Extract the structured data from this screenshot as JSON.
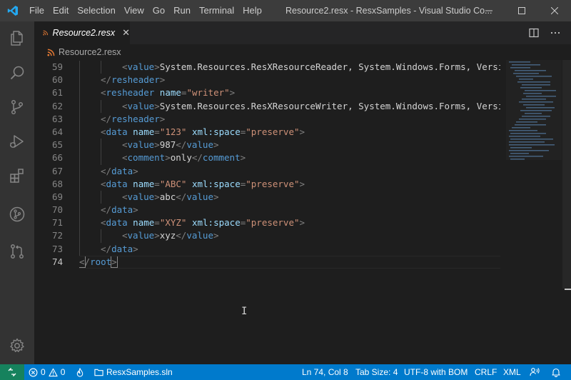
{
  "window": {
    "title": "Resource2.resx - ResxSamples - Visual Studio Co..."
  },
  "menu": [
    "File",
    "Edit",
    "Selection",
    "View",
    "Go",
    "Run",
    "Terminal",
    "Help"
  ],
  "tab": {
    "label": "Resource2.resx",
    "close": "✕"
  },
  "breadcrumb": {
    "file": "Resource2.resx"
  },
  "editor": {
    "cursor_glyph": "I",
    "active_line": 74,
    "lines": [
      {
        "n": "59"
      },
      {
        "n": "60"
      },
      {
        "n": "61"
      },
      {
        "n": "62"
      },
      {
        "n": "63"
      },
      {
        "n": "64"
      },
      {
        "n": "65"
      },
      {
        "n": "66"
      },
      {
        "n": "67"
      },
      {
        "n": "68"
      },
      {
        "n": "69"
      },
      {
        "n": "70"
      },
      {
        "n": "71"
      },
      {
        "n": "72"
      },
      {
        "n": "73"
      },
      {
        "n": "74"
      }
    ],
    "code": {
      "l59_tag": "value",
      "l59_text": "System.Resources.ResXResourceReader, System.Windows.Forms, Versio",
      "l60_tag": "resheader",
      "l61_tag": "resheader",
      "l61_attr": "name",
      "l61_val": "\"writer\"",
      "l62_tag": "value",
      "l62_text": "System.Resources.ResXResourceWriter, System.Windows.Forms, Versio",
      "l63_tag": "resheader",
      "l64_tag": "data",
      "l64_attr1": "name",
      "l64_val1": "\"123\"",
      "l64_attr2": "xml:space",
      "l64_val2": "\"preserve\"",
      "l65_tag": "value",
      "l65_text": "987",
      "l66_tag": "comment",
      "l66_text": "only",
      "l67_tag": "data",
      "l68_tag": "data",
      "l68_attr1": "name",
      "l68_val1": "\"ABC\"",
      "l68_attr2": "xml:space",
      "l68_val2": "\"preserve\"",
      "l69_tag": "value",
      "l69_text": "abc",
      "l70_tag": "data",
      "l71_tag": "data",
      "l71_attr1": "name",
      "l71_val1": "\"XYZ\"",
      "l71_attr2": "xml:space",
      "l71_val2": "\"preserve\"",
      "l72_tag": "value",
      "l72_text": "xyz",
      "l73_tag": "data",
      "l74_tag": "root"
    }
  },
  "statusbar": {
    "errors": "0",
    "warnings": "0",
    "solution": "ResxSamples.sln",
    "position": "Ln 74, Col 8",
    "tab_size": "Tab Size: 4",
    "encoding": "UTF-8 with BOM",
    "eol": "CRLF",
    "language": "XML"
  },
  "colors": {
    "accent": "#007acc",
    "remote": "#16825d",
    "tag": "#569cd6",
    "attr": "#9cdcfe",
    "string": "#ce9178",
    "file_icon": "#e37933"
  },
  "icons": {
    "activity": [
      "files-icon",
      "search-icon",
      "source-control-icon",
      "run-debug-icon",
      "extensions-icon",
      "git-graph-icon",
      "pull-request-icon",
      "settings-gear-icon"
    ]
  }
}
